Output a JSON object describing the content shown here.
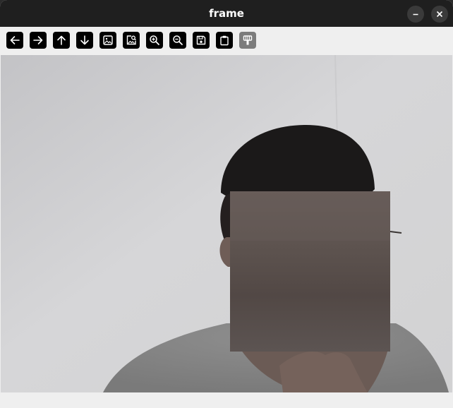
{
  "window": {
    "title": "frame"
  },
  "toolbar": {
    "buttons": [
      {
        "name": "pan-left",
        "icon": "arrow-left-icon",
        "enabled": true
      },
      {
        "name": "pan-right",
        "icon": "arrow-right-icon",
        "enabled": true
      },
      {
        "name": "pan-up",
        "icon": "arrow-up-icon",
        "enabled": true
      },
      {
        "name": "pan-down",
        "icon": "arrow-down-icon",
        "enabled": true
      },
      {
        "name": "zoom-original",
        "icon": "image-icon",
        "enabled": true
      },
      {
        "name": "zoom-fit",
        "icon": "image-search-icon",
        "enabled": true
      },
      {
        "name": "zoom-in",
        "icon": "zoom-in-icon",
        "enabled": true
      },
      {
        "name": "zoom-out",
        "icon": "zoom-out-icon",
        "enabled": true
      },
      {
        "name": "save-image",
        "icon": "save-icon",
        "enabled": true
      },
      {
        "name": "copy-clipboard",
        "icon": "clipboard-icon",
        "enabled": true
      },
      {
        "name": "properties",
        "icon": "paint-roller-icon",
        "enabled": false
      }
    ]
  },
  "colors": {
    "titlebar": "#1f1f1f",
    "toolbar": "#efefef",
    "button": "#000000",
    "button_disabled": "#7c7c7c",
    "blur_patch": "#5a524f"
  },
  "statusbar": {
    "text": ""
  }
}
